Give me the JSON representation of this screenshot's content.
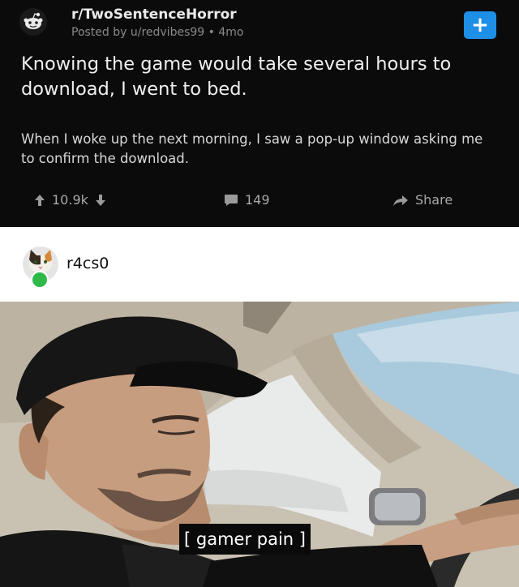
{
  "post": {
    "subreddit": "r/TwoSentenceHorror",
    "meta": "Posted by u/redvibes99 • 4mo",
    "title": "Knowing the game would take several hours to download, I went to bed.",
    "body": "When I woke up the next morning, I saw a pop-up window asking me to confirm the download.",
    "votes": "10.9k",
    "comments": "149",
    "share_label": "Share",
    "join_symbol": "+"
  },
  "meme": {
    "username": "r4cs0",
    "caption": "[ gamer pain ]"
  },
  "colors": {
    "card_bg": "#0b0b0b",
    "accent_blue": "#1e8fe6",
    "badge_green": "#2fb94a"
  }
}
